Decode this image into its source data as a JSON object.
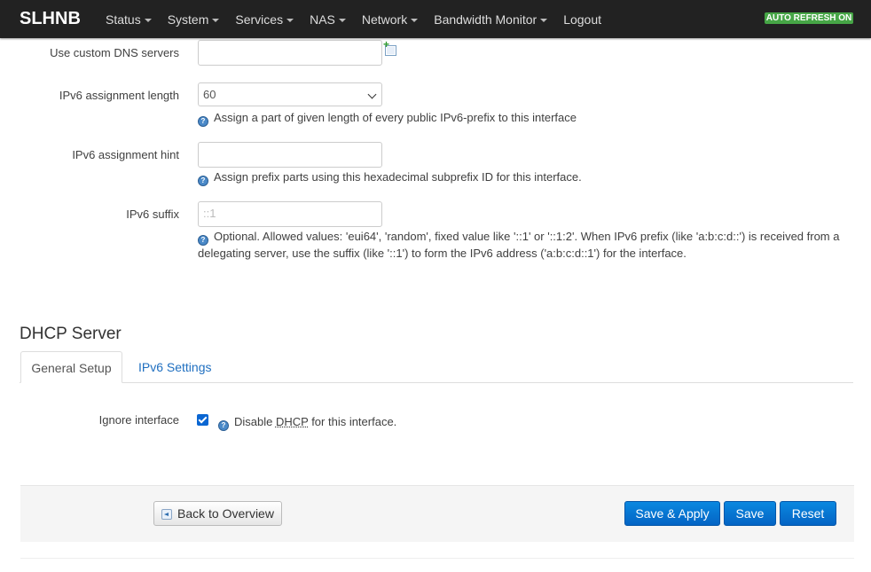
{
  "topbar": {
    "brand": "SLHNB",
    "nav": [
      "Status",
      "System",
      "Services",
      "NAS",
      "Network",
      "Bandwidth Monitor",
      "Logout"
    ],
    "auto_refresh": "AUTO REFRESH ON"
  },
  "form": {
    "custom_dns": {
      "label": "Use custom DNS servers",
      "value": ""
    },
    "ipv6_assign_length": {
      "label": "IPv6 assignment length",
      "value": "60",
      "help": "Assign a part of given length of every public IPv6-prefix to this interface"
    },
    "ipv6_assign_hint": {
      "label": "IPv6 assignment hint",
      "value": "",
      "help": "Assign prefix parts using this hexadecimal subprefix ID for this interface."
    },
    "ipv6_suffix": {
      "label": "IPv6 suffix",
      "placeholder": "::1",
      "help_line1": "Optional. Allowed values: 'eui64', 'random', fixed value like '::1' or '::1:2'. When IPv6 prefix (like 'a:b:c:d::') is received from a",
      "help_line2": "delegating server, use the suffix (like '::1') to form the IPv6 address ('a:b:c:d::1') for the interface."
    }
  },
  "dhcp": {
    "title": "DHCP Server",
    "tabs": [
      "General Setup",
      "IPv6 Settings"
    ],
    "ignore_label": "Ignore interface",
    "ignore_checked": true,
    "ignore_help_prefix": "Disable ",
    "ignore_help_abbr": "DHCP",
    "ignore_help_suffix": " for this interface."
  },
  "actions": {
    "back": "Back to Overview",
    "save_apply": "Save & Apply",
    "save": "Save",
    "reset": "Reset"
  }
}
